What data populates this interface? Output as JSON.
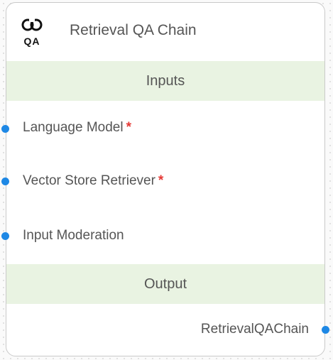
{
  "node": {
    "title": "Retrieval QA Chain",
    "icon_name": "retrieval-qa-chain-icon",
    "icon_text": "QA"
  },
  "inputs": {
    "section_label": "Inputs",
    "items": [
      {
        "label": "Language Model",
        "required": true,
        "required_mark": "*"
      },
      {
        "label": "Vector Store Retriever",
        "required": true,
        "required_mark": "*"
      },
      {
        "label": "Input Moderation",
        "required": false,
        "required_mark": ""
      }
    ]
  },
  "output": {
    "section_label": "Output",
    "items": [
      {
        "label": "RetrievalQAChain"
      }
    ]
  },
  "colors": {
    "section_background": "#e9f3e2",
    "handle": "#1e88e5",
    "required": "#e53935",
    "border": "#c9c9c9",
    "text": "#555555"
  }
}
